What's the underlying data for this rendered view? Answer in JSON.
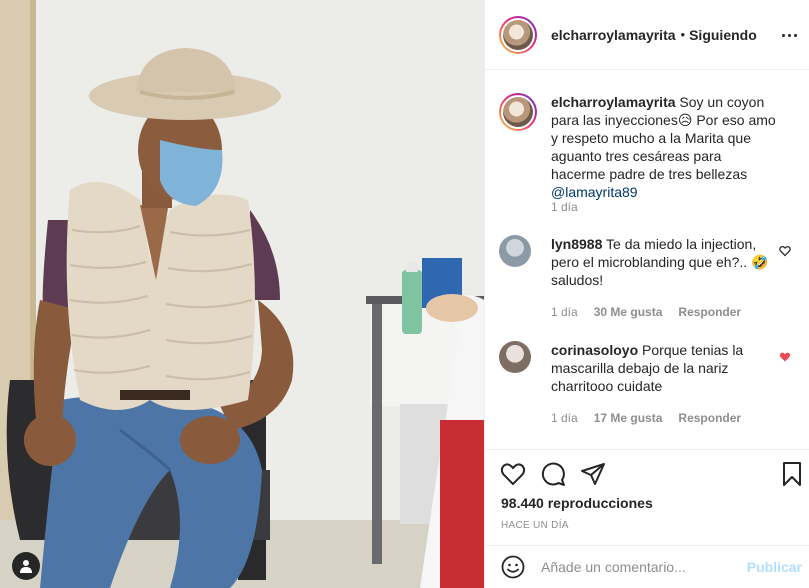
{
  "post": {
    "author": "elcharroylamayrita",
    "separator": "•",
    "follow_status": "Siguiendo"
  },
  "caption": {
    "username": "elcharroylamayrita",
    "text": "Soy un coyon para las inyecciones😥 Por eso amo y respeto mucho a la Marita que aguanto tres cesáreas para hacerme padre de tres bellezas",
    "mention": "@lamayrita89",
    "time": "1 día"
  },
  "comments": [
    {
      "username": "lyn8988",
      "text": "Te da miedo la injection, pero el microblanding que eh?.. 🤣 saludos!",
      "time": "1 día",
      "likes": "30 Me gusta",
      "reply": "Responder",
      "liked": false
    },
    {
      "username": "corinasoloyo",
      "text": "Porque tenias la mascarilla debajo de la nariz charritooo cuidate",
      "time": "1 día",
      "likes": "17 Me gusta",
      "reply": "Responder",
      "liked": true
    }
  ],
  "stats": {
    "views": "98.440 reproducciones",
    "posted": "HACE UN DÍA"
  },
  "composer": {
    "placeholder": "Añade un comentario...",
    "post_label": "Publicar"
  },
  "colors": {
    "like_red": "#ed4956",
    "mention_blue": "#00376b",
    "post_disabled": "#b2dffc"
  },
  "icons": [
    "more-options-icon",
    "heart-icon",
    "comment-icon",
    "share-icon",
    "bookmark-icon",
    "emoji-icon",
    "user-tag-icon"
  ]
}
